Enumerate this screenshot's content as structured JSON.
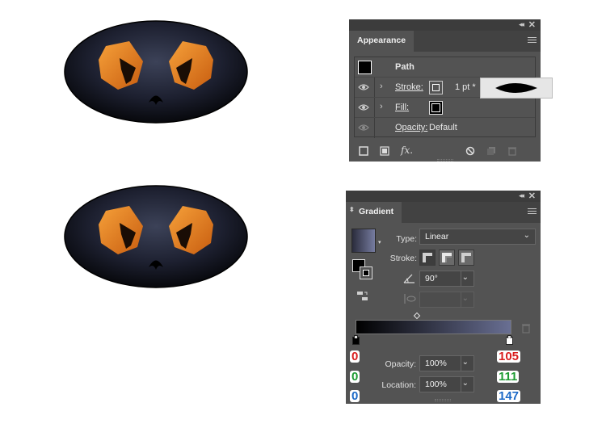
{
  "appearance_panel": {
    "tab_label": "Appearance",
    "header_label": "Path",
    "rows": [
      {
        "label": "Stroke:",
        "value": "1 pt *"
      },
      {
        "label": "Fill:"
      },
      {
        "label": "Opacity:",
        "value": "Default"
      }
    ],
    "footer_icons": [
      "new-stroke-icon",
      "new-fill-icon",
      "fx-icon",
      "clear-icon",
      "duplicate-icon",
      "trash-icon"
    ],
    "fx_label": "fx."
  },
  "gradient_panel": {
    "tab_label": "Gradient",
    "type_label": "Type:",
    "type_value": "Linear",
    "stroke_label": "Stroke:",
    "angle_value": "90°",
    "opacity_label": "Opacity:",
    "opacity_value": "100%",
    "location_label": "Location:",
    "location_value": "100%",
    "gradient_start_color": "#000000",
    "gradient_end_color": "#696f93"
  },
  "annotations": {
    "left_stop_rgb": [
      "0",
      "0",
      "0"
    ],
    "right_stop_rgb": [
      "105",
      "111",
      "147"
    ]
  },
  "colors": {
    "panel_bg": "#535353",
    "eye_orange": "#e8801f",
    "face_dark": "#1a1d28"
  }
}
